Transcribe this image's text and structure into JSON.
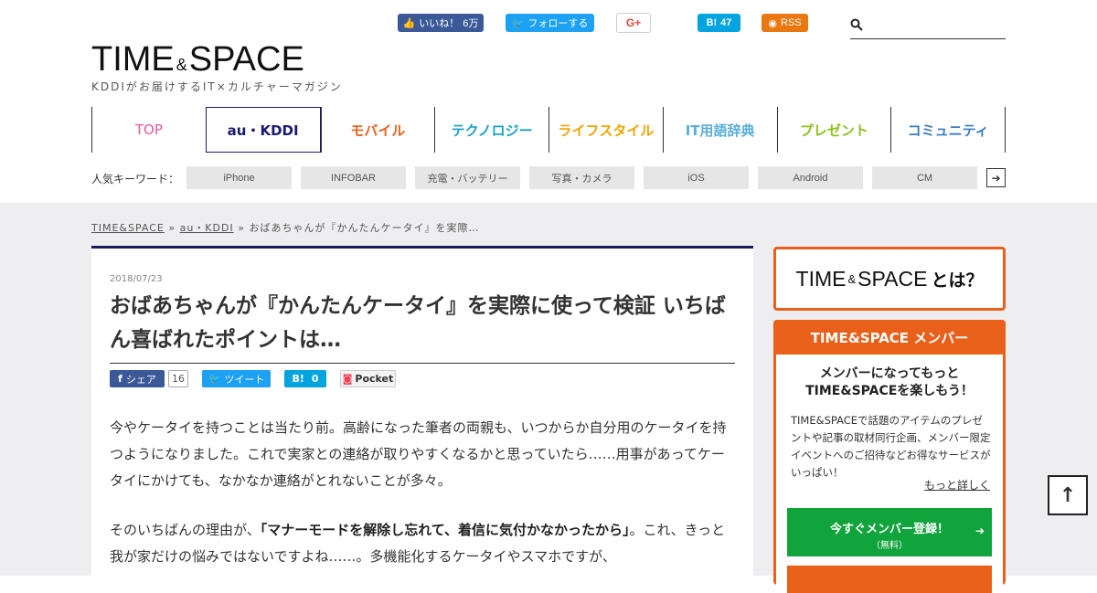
{
  "social": {
    "facebook_label": "いいね！",
    "facebook_count": "6万",
    "twitter_label": "フォローする",
    "gplus_label": "G+",
    "hatena_label": "B!",
    "hatena_count": "47",
    "rss_label": "RSS"
  },
  "search": {
    "placeholder": ""
  },
  "logo": {
    "part1": "TIME",
    "amp": "&",
    "part2": "SPACE",
    "tagline": "KDDIがお届けするIT×カルチャーマガジン"
  },
  "nav": [
    {
      "label": "TOP",
      "color": "#e8559a"
    },
    {
      "label": "au・KDDI",
      "color": "#1a1a6e",
      "active": true
    },
    {
      "label": "モバイル",
      "color": "#e8601a"
    },
    {
      "label": "テクノロジー",
      "color": "#18a2c8"
    },
    {
      "label": "ライフスタイル",
      "color": "#f0a500"
    },
    {
      "label": "IT用語辞典",
      "color": "#5aaed8"
    },
    {
      "label": "プレゼント",
      "color": "#8dc21f"
    },
    {
      "label": "コミュニティ",
      "color": "#3d7bc4"
    }
  ],
  "keywords": {
    "label": "人気キーワード：",
    "items": [
      "iPhone",
      "INFOBAR",
      "充電・バッテリー",
      "写真・カメラ",
      "iOS",
      "Android",
      "CM"
    ],
    "next_icon": "arrow-right-icon"
  },
  "breadcrumb": {
    "home": "TIME&SPACE",
    "cat": "au・KDDI",
    "current": "おばあちゃんが『かんたんケータイ』を実際…",
    "sep": "»"
  },
  "article": {
    "date": "2018/07/23",
    "title": "おばあちゃんが『かんたんケータイ』を実際に使って検証 いちばん喜ばれたポイントは…",
    "share": {
      "fb": "シェア",
      "fb_count": "16",
      "tw": "ツイート",
      "hb": "B!",
      "hb_count": "0",
      "pocket": "Pocket"
    },
    "p1": "今やケータイを持つことは当たり前。高齢になった筆者の両親も、いつからか自分用のケータイを持つようになりました。これで実家との連絡が取りやすくなるかと思っていたら……用事があってケータイにかけても、なかなか連絡がとれないことが多々。",
    "p2_a": "そのいちばんの理由が、",
    "p2_b": "「マナーモードを解除し忘れて、着信に気付かなかったから」",
    "p2_c": "。これ、きっと我が家だけの悩みではないですよね……。多機能化するケータイやスマホですが、"
  },
  "sidebar": {
    "about_part1": "TIME",
    "about_amp": "&",
    "about_part2": "SPACE",
    "about_suffix": "とは？",
    "member_head": "TIME&SPACE メンバー",
    "member_title1": "メンバーになってもっと",
    "member_title2": "TIME&SPACEを楽しもう！",
    "member_desc": "TIME&SPACEで話題のアイテムのプレゼントや記事の取材同行企画、メンバー限定イベントへのご招待などお得なサービスがいっぱい！",
    "more": "もっと詳しく",
    "register": "今すぐメンバー登録！",
    "register_sub": "（無料）"
  },
  "totop": "↑"
}
